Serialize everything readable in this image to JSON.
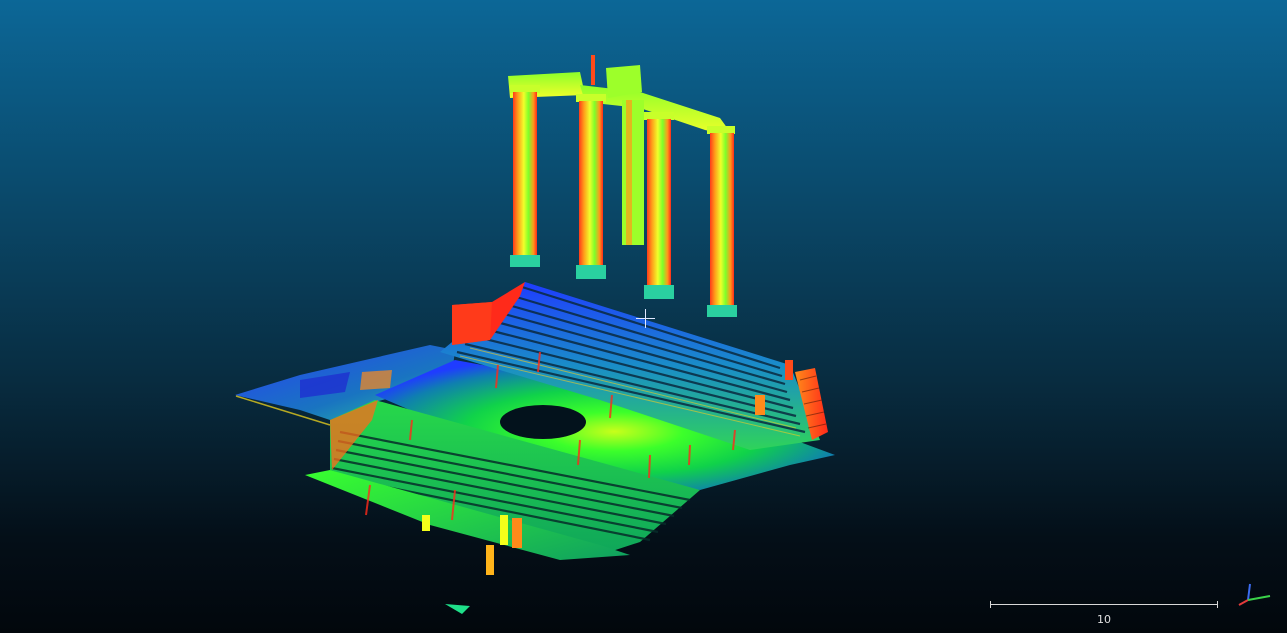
{
  "viewer": {
    "background_top": "#0c6797",
    "background_bottom": "#02070c"
  },
  "scale_bar": {
    "label": "10"
  },
  "axes": {
    "x_color": "#e23b3b",
    "y_color": "#3bd24a",
    "z_color": "#3b6cf0"
  },
  "point_cloud": {
    "colormap": [
      "#1f3cff",
      "#00e5ff",
      "#39ff2f",
      "#f4ff1a",
      "#ff8a1a",
      "#ff2a1a"
    ],
    "subject": "columns-and-steps-scan"
  }
}
